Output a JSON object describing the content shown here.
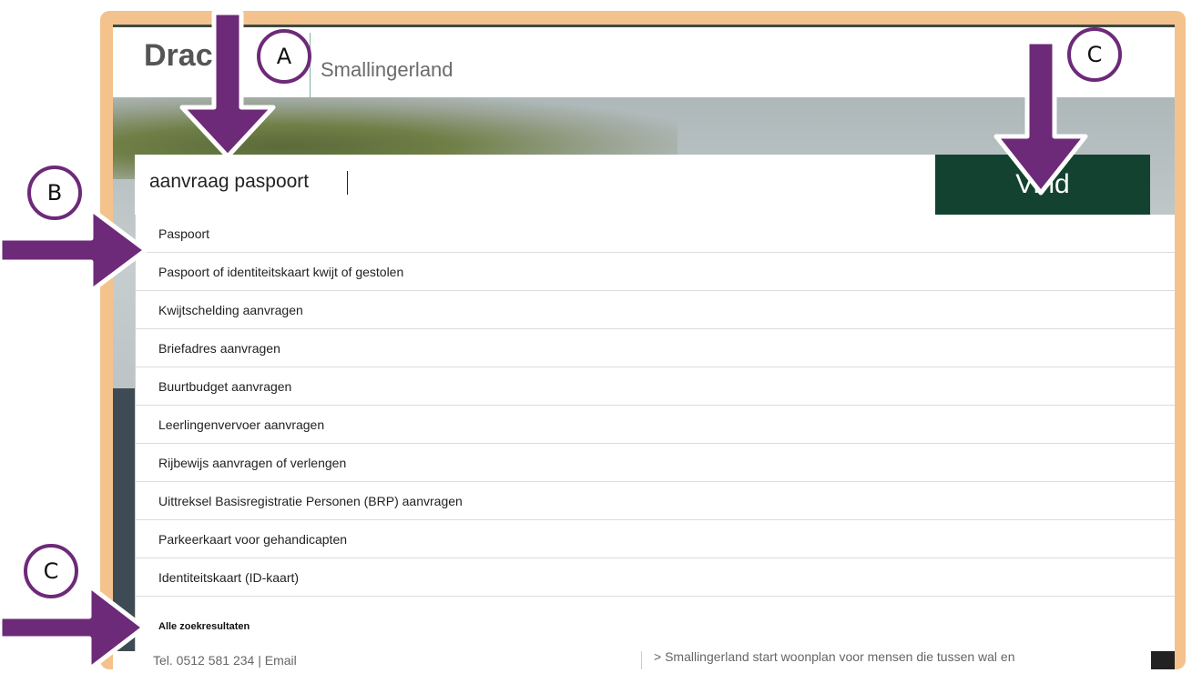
{
  "header": {
    "logo_main": "Drac",
    "logo_sub": "Smallingerland"
  },
  "search": {
    "value": "aanvraag paspoort",
    "button_label": "Vind"
  },
  "suggestions": [
    {
      "label": "Paspoort"
    },
    {
      "label": "Paspoort of identiteitskaart kwijt of gestolen"
    },
    {
      "label": "Kwijtschelding aanvragen"
    },
    {
      "label": "Briefadres aanvragen"
    },
    {
      "label": "Buurtbudget aanvragen"
    },
    {
      "label": "Leerlingenvervoer aanvragen"
    },
    {
      "label": "Rijbewijs aanvragen of verlengen"
    },
    {
      "label": "Uittreksel Basisregistratie Personen (BRP) aanvragen"
    },
    {
      "label": "Parkeerkaart voor gehandicapten"
    },
    {
      "label": "Identiteitskaart (ID-kaart)"
    }
  ],
  "all_results_label": "Alle zoekresultaten",
  "footer": {
    "left_text": "Tel. 0512 581 234  |  Email",
    "right_text": "> Smallingerland start woonplan voor mensen die tussen wal en"
  },
  "callouts": {
    "a": "A",
    "b": "B",
    "c_top": "C",
    "c_bottom": "C"
  },
  "colors": {
    "callout_border": "#6d2a78",
    "arrow": "#6d2a78",
    "frame": "#f4c28d",
    "button_bg": "#134330"
  }
}
